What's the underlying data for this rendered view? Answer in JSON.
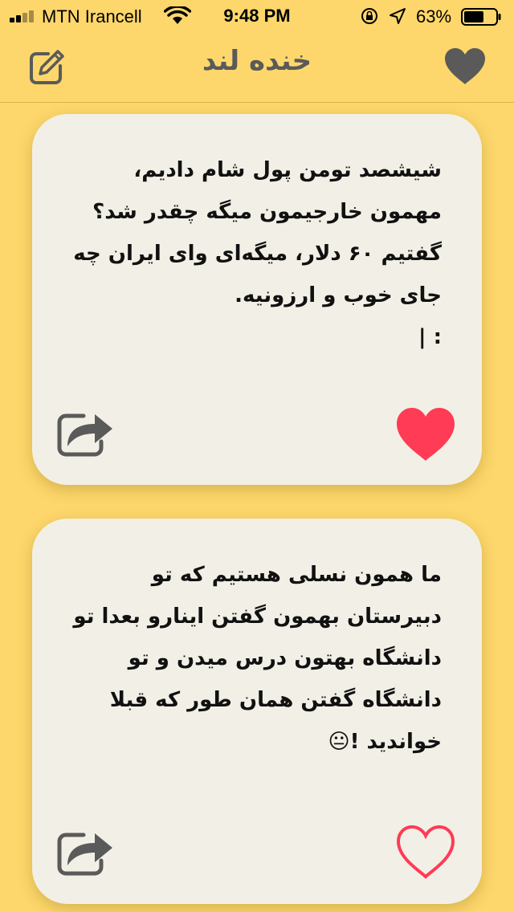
{
  "status_bar": {
    "carrier": "MTN Irancell",
    "time": "9:48 PM",
    "battery_percent": "63%",
    "battery_level": 0.63
  },
  "nav": {
    "title": "خنده لند",
    "compose_icon": "compose-icon",
    "favorites_icon": "heart-icon"
  },
  "cards": [
    {
      "text": "شیشصد تومن پول شام دادیم،\nمهمون خارجیمون میگه چقدر شد؟\nگفتیم ۶۰ دلار، میگه‌ای وای ایران چه جای خوب و ارزونیه.\n: |",
      "liked": true,
      "share_icon": "share-icon",
      "like_icon": "heart-filled-icon"
    },
    {
      "text": "ما همون نسلی هستیم که تو دبیرستان بهمون گفتن اینارو بعدا تو دانشگاه بهتون درس میدن و تو دانشگاه گفتن همان طور که قبلا خواندید !😐",
      "liked": false,
      "share_icon": "share-icon",
      "like_icon": "heart-outline-icon"
    }
  ],
  "colors": {
    "background": "#fdd76b",
    "card": "#f2f0e6",
    "like_active": "#ff3b55",
    "icon_gray": "#5a5a5a"
  }
}
